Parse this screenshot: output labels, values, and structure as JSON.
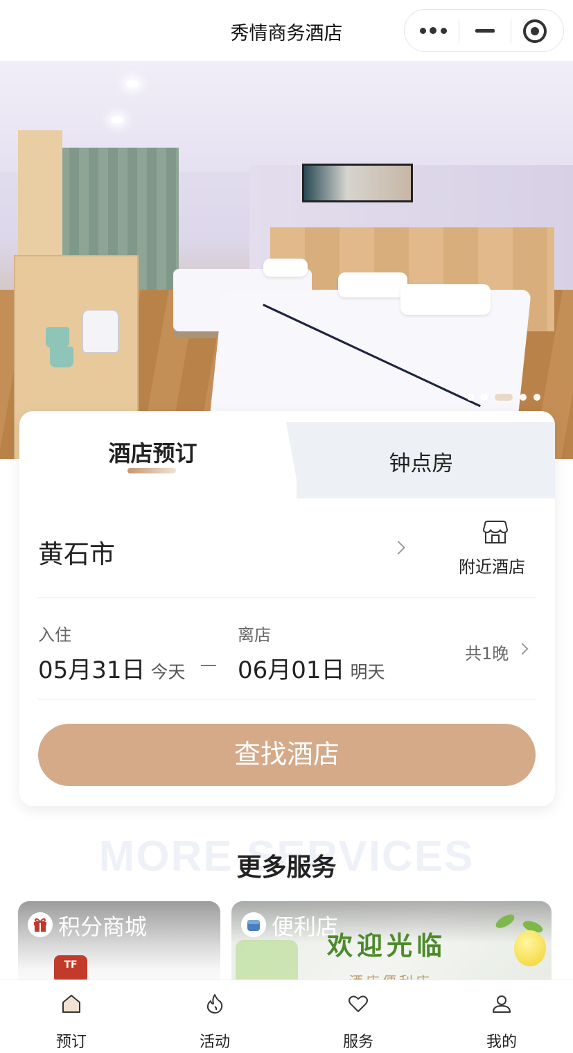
{
  "navbar": {
    "title": "秀情商务酒店"
  },
  "hero": {
    "carousel_count": 5,
    "carousel_active_index": 2
  },
  "booking": {
    "tabs": [
      "酒店预订",
      "钟点房"
    ],
    "city": "黄石市",
    "nearby_label": "附近酒店",
    "checkin_label": "入住",
    "checkin_date": "05月31日",
    "checkin_day": "今天",
    "checkout_label": "离店",
    "checkout_date": "06月01日",
    "checkout_day": "明天",
    "nights": "共1晚",
    "search_button": "查找酒店"
  },
  "services": {
    "bg_title": "MORE SERVICES",
    "title": "更多服务",
    "tiles": [
      {
        "label": "积分商城",
        "icon": "gift-icon",
        "logo_text": "TF"
      },
      {
        "label": "便利店",
        "icon": "store-basket-icon",
        "promo": "欢迎光临",
        "promo_sub": "酒店便利店"
      }
    ]
  },
  "tabbar": {
    "items": [
      {
        "label": "预订",
        "icon": "home-icon"
      },
      {
        "label": "活动",
        "icon": "flame-icon"
      },
      {
        "label": "服务",
        "icon": "heart-icon"
      },
      {
        "label": "我的",
        "icon": "user-icon"
      }
    ]
  },
  "colors": {
    "accent": "#d4aa88",
    "tab_inactive_bg": "#edf0f4"
  }
}
